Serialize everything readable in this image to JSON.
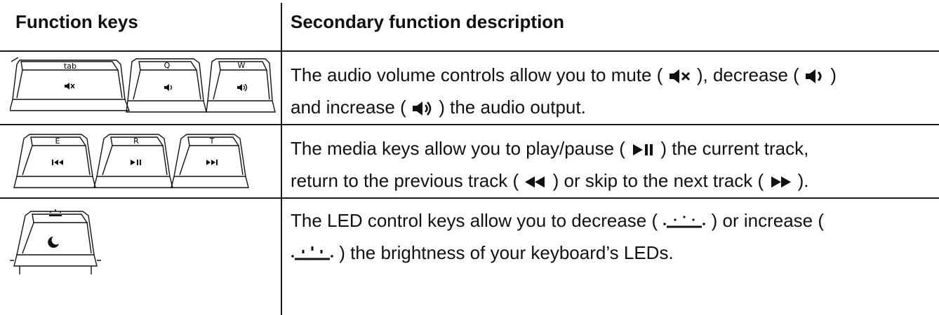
{
  "header": {
    "col1": "Function keys",
    "col2": "Secondary function description"
  },
  "rows": [
    {
      "keys": [
        "tab",
        "Q",
        "W"
      ],
      "icons": [
        "mute-icon",
        "volume-down-icon",
        "volume-up-icon"
      ],
      "text_a": "The audio volume controls allow you to mute (",
      "text_b": "), decrease (",
      "text_c": ")",
      "text_d": "and increase (",
      "text_e": ") the audio output."
    },
    {
      "keys": [
        "E",
        "R",
        "T"
      ],
      "icons": [
        "previous-track-icon",
        "play-pause-icon",
        "next-track-icon"
      ],
      "text_a": "The media keys allow you to play/pause (",
      "text_b": ") the current track,",
      "text_c": "return to the previous track (",
      "text_d": ") or skip to the next track (",
      "text_e": ")."
    },
    {
      "keys": [
        ""
      ],
      "icons": [
        "moon-icon"
      ],
      "text_a": "The LED control keys allow you to decrease (",
      "text_b": ") or increase (",
      "text_c": ") the brightness of your keyboard’s LEDs."
    }
  ]
}
